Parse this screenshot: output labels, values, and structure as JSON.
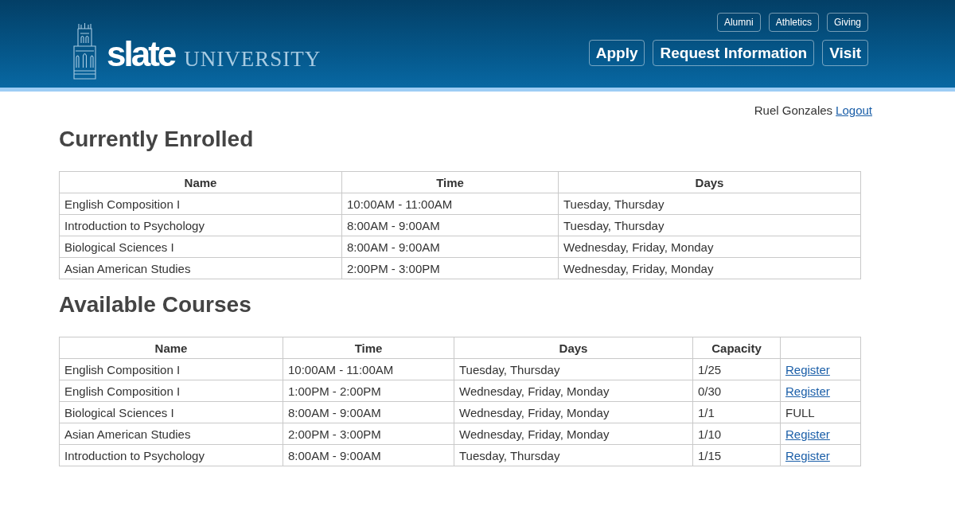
{
  "header": {
    "logo": {
      "wordmark": "slate",
      "subtitle": "UNIVERSITY"
    },
    "utility_links": [
      "Alumni",
      "Athletics",
      "Giving"
    ],
    "action_buttons": [
      "Apply",
      "Request Information",
      "Visit"
    ]
  },
  "user_bar": {
    "user_name": "Ruel Gonzales",
    "logout_link": "Logout"
  },
  "enrolled": {
    "title": "Currently Enrolled",
    "columns": [
      "Name",
      "Time",
      "Days"
    ],
    "rows": [
      {
        "name": "English Composition I",
        "time": "10:00AM - 11:00AM",
        "days": "Tuesday, Thursday"
      },
      {
        "name": "Introduction to Psychology",
        "time": "8:00AM - 9:00AM",
        "days": "Tuesday, Thursday"
      },
      {
        "name": "Biological Sciences I",
        "time": "8:00AM - 9:00AM",
        "days": "Wednesday, Friday, Monday"
      },
      {
        "name": "Asian American Studies",
        "time": "2:00PM - 3:00PM",
        "days": "Wednesday, Friday, Monday"
      }
    ]
  },
  "available": {
    "title": "Available Courses",
    "columns": [
      "Name",
      "Time",
      "Days",
      "Capacity"
    ],
    "rows": [
      {
        "name": "English Composition I",
        "time": "10:00AM - 11:00AM",
        "days": "Tuesday, Thursday",
        "capacity": "1/25",
        "action": {
          "kind": "link",
          "text": "Register"
        }
      },
      {
        "name": "English Composition I",
        "time": "1:00PM - 2:00PM",
        "days": "Wednesday, Friday, Monday",
        "capacity": "0/30",
        "action": {
          "kind": "link",
          "text": "Register"
        }
      },
      {
        "name": "Biological Sciences I",
        "time": "8:00AM - 9:00AM",
        "days": "Wednesday, Friday, Monday",
        "capacity": "1/1",
        "action": {
          "kind": "status",
          "text": "FULL"
        }
      },
      {
        "name": "Asian American Studies",
        "time": "2:00PM - 3:00PM",
        "days": "Wednesday, Friday, Monday",
        "capacity": "1/10",
        "action": {
          "kind": "link",
          "text": "Register"
        }
      },
      {
        "name": "Introduction to Psychology",
        "time": "8:00AM - 9:00AM",
        "days": "Tuesday, Thursday",
        "capacity": "1/15",
        "action": {
          "kind": "link",
          "text": "Register"
        }
      }
    ]
  }
}
